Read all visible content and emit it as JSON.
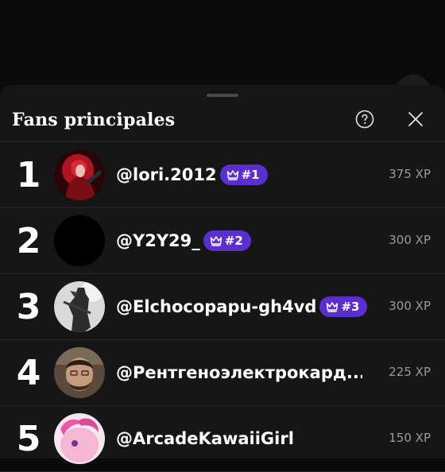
{
  "sheet": {
    "title": "Fans principales",
    "help_icon": "help-circle-icon",
    "close_icon": "close-icon"
  },
  "fans": [
    {
      "rank": "1",
      "username": "@lori.2012",
      "badge": "#1",
      "xp": "375 XP"
    },
    {
      "rank": "2",
      "username": "@Y2Y29_",
      "badge": "#2",
      "xp": "300 XP"
    },
    {
      "rank": "3",
      "username": "@Elchocopapu-gh4vd",
      "badge": "#3",
      "xp": "300 XP"
    },
    {
      "rank": "4",
      "username": "@Рентгеноэлектрокард...",
      "badge": "",
      "xp": "225 XP"
    },
    {
      "rank": "5",
      "username": "@ArcadeKawaiiGirl",
      "badge": "",
      "xp": "150 XP"
    }
  ],
  "colors": {
    "sheet_bg": "#161616",
    "badge_bg": "#5b2ed0",
    "xp_text": "#9a9a9a"
  }
}
